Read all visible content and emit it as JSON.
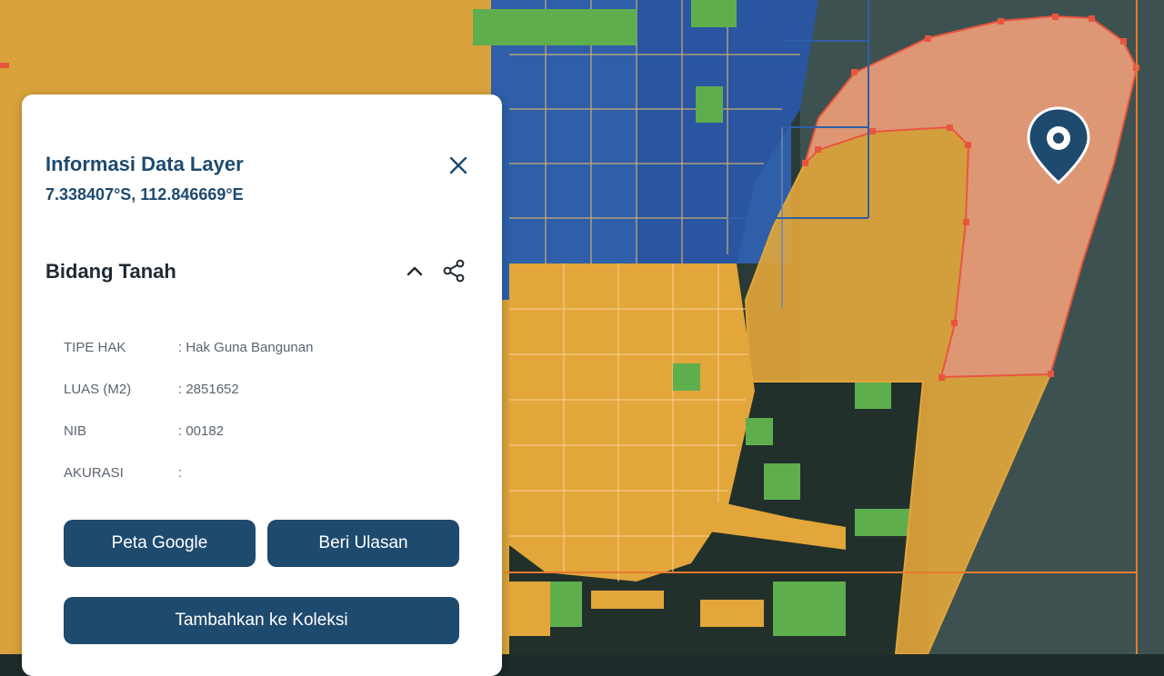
{
  "panel": {
    "title": "Informasi Data Layer",
    "coordinates": "7.338407°S, 112.846669°E",
    "close_icon": "close-icon"
  },
  "section": {
    "title": "Bidang Tanah",
    "collapse_icon": "chevron-up-icon",
    "share_icon": "share-icon"
  },
  "attributes": [
    {
      "label": "TIPE HAK",
      "value": ": Hak Guna Bangunan"
    },
    {
      "label": "LUAS (M2)",
      "value": ": 2851652"
    },
    {
      "label": "NIB",
      "value": ": 00182"
    },
    {
      "label": "AKURASI",
      "value": ":"
    }
  ],
  "buttons": {
    "google_maps": "Peta Google",
    "review": "Beri Ulasan",
    "add_collection": "Tambahkan ke Koleksi"
  },
  "map": {
    "marker_icon": "location-pin-icon",
    "colors": {
      "primary": "#1e4a6e",
      "parcel_hgb": "#e3a63a",
      "parcel_green": "#5fae4e",
      "parcel_blue": "#2f5fa8",
      "selected_parcel": "#f4a07a",
      "selected_outline": "#e8553f",
      "water": "#3a4f4c"
    }
  }
}
